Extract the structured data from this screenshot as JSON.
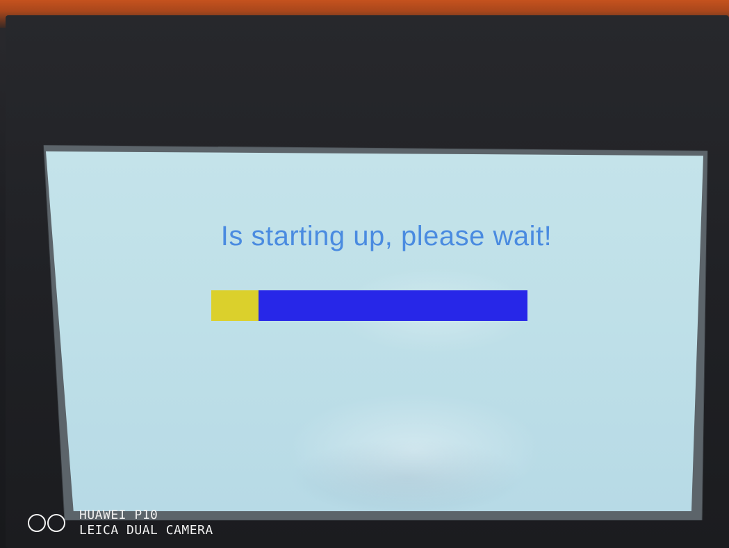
{
  "screen": {
    "message": "Is starting up, please wait!",
    "message_color": "#4a8be0",
    "background_color": "#c2e2ea"
  },
  "progress": {
    "fraction": 0.15,
    "fill_color": "#dbd02c",
    "track_color": "#2727e8"
  },
  "watermark": {
    "logo_icon": "leica-circles-icon",
    "line1": "HUAWEI P10",
    "line2": "LEICA DUAL CAMERA"
  }
}
